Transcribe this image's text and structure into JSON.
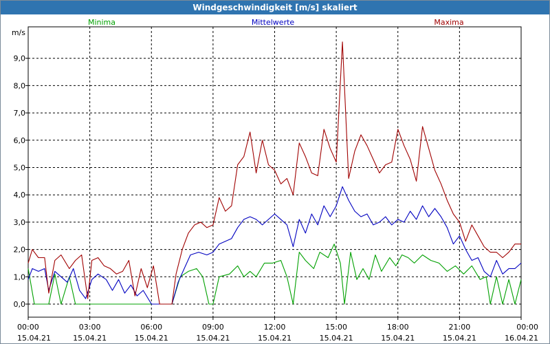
{
  "window": {
    "title": "Windgeschwindigkeit [m/s] skaliert"
  },
  "colors": {
    "minima": "#00a000",
    "mittel": "#0000c0",
    "maxima": "#a00000",
    "grid": "#000000"
  },
  "chart_data": {
    "type": "line",
    "title": "Windgeschwindigkeit [m/s] skaliert",
    "ylabel": "m/s",
    "ylim": [
      -0.5,
      10.0
    ],
    "yticks": [
      "0,0",
      "1,0",
      "2,0",
      "3,0",
      "4,0",
      "5,0",
      "6,0",
      "7,0",
      "8,0",
      "9,0"
    ],
    "grid": true,
    "legend": "top",
    "x_ticks": [
      {
        "time": "00:00",
        "date": "15.04.21"
      },
      {
        "time": "03:00",
        "date": "15.04.21"
      },
      {
        "time": "06:00",
        "date": "15.04.21"
      },
      {
        "time": "09:00",
        "date": "15.04.21"
      },
      {
        "time": "12:00",
        "date": "15.04.21"
      },
      {
        "time": "15:00",
        "date": "15.04.21"
      },
      {
        "time": "18:00",
        "date": "15.04.21"
      },
      {
        "time": "21:00",
        "date": "15.04.21"
      },
      {
        "time": "00:00",
        "date": "16.04.21"
      }
    ],
    "x_unit_note": "x values are hours of 15.04.21 (0-24)",
    "series": [
      {
        "name": "Minima",
        "color": "#00a000",
        "points": [
          [
            0,
            1.3
          ],
          [
            0.3,
            0
          ],
          [
            1.0,
            0
          ],
          [
            1.3,
            1.1
          ],
          [
            1.6,
            0
          ],
          [
            2.0,
            1.0
          ],
          [
            2.3,
            0
          ],
          [
            3.0,
            0
          ],
          [
            4.0,
            0
          ],
          [
            5.0,
            0
          ],
          [
            6.0,
            0
          ],
          [
            7.0,
            0
          ],
          [
            7.4,
            1.0
          ],
          [
            7.8,
            1.2
          ],
          [
            8.2,
            1.3
          ],
          [
            8.5,
            1.0
          ],
          [
            8.8,
            0
          ],
          [
            9.0,
            0
          ],
          [
            9.3,
            1.0
          ],
          [
            9.8,
            1.1
          ],
          [
            10.2,
            1.4
          ],
          [
            10.5,
            1.0
          ],
          [
            10.8,
            1.2
          ],
          [
            11.1,
            1.0
          ],
          [
            11.5,
            1.5
          ],
          [
            11.9,
            1.5
          ],
          [
            12.3,
            1.6
          ],
          [
            12.6,
            1.0
          ],
          [
            12.9,
            0
          ],
          [
            13.2,
            1.9
          ],
          [
            13.5,
            1.6
          ],
          [
            13.9,
            1.3
          ],
          [
            14.2,
            1.9
          ],
          [
            14.6,
            1.7
          ],
          [
            14.9,
            2.2
          ],
          [
            15.2,
            1.5
          ],
          [
            15.4,
            0
          ],
          [
            15.7,
            1.9
          ],
          [
            16.0,
            0.9
          ],
          [
            16.3,
            1.3
          ],
          [
            16.6,
            0.9
          ],
          [
            16.9,
            1.8
          ],
          [
            17.2,
            1.2
          ],
          [
            17.6,
            1.7
          ],
          [
            17.9,
            1.4
          ],
          [
            18.2,
            1.8
          ],
          [
            18.5,
            1.7
          ],
          [
            18.8,
            1.5
          ],
          [
            19.2,
            1.8
          ],
          [
            19.6,
            1.6
          ],
          [
            20.0,
            1.5
          ],
          [
            20.4,
            1.2
          ],
          [
            20.8,
            1.4
          ],
          [
            21.2,
            1.1
          ],
          [
            21.6,
            1.4
          ],
          [
            22.0,
            0.9
          ],
          [
            22.3,
            1.0
          ],
          [
            22.5,
            0
          ],
          [
            22.8,
            1.0
          ],
          [
            23.1,
            0
          ],
          [
            23.4,
            0.9
          ],
          [
            23.7,
            0
          ],
          [
            24.0,
            0.9
          ]
        ]
      },
      {
        "name": "Mittelwerte",
        "color": "#0000c0",
        "points": [
          [
            0,
            0.9
          ],
          [
            0.2,
            1.3
          ],
          [
            0.5,
            1.2
          ],
          [
            0.8,
            1.3
          ],
          [
            1.0,
            0.5
          ],
          [
            1.3,
            1.2
          ],
          [
            1.6,
            1.0
          ],
          [
            1.9,
            0.8
          ],
          [
            2.2,
            1.3
          ],
          [
            2.5,
            0.5
          ],
          [
            2.8,
            0.2
          ],
          [
            3.1,
            0.9
          ],
          [
            3.4,
            1.1
          ],
          [
            3.8,
            0.9
          ],
          [
            4.1,
            0.5
          ],
          [
            4.4,
            0.9
          ],
          [
            4.7,
            0.4
          ],
          [
            5.0,
            0.7
          ],
          [
            5.3,
            0.3
          ],
          [
            5.6,
            0.5
          ],
          [
            6.0,
            0
          ],
          [
            6.5,
            0
          ],
          [
            7.0,
            0
          ],
          [
            7.3,
            0.8
          ],
          [
            7.6,
            1.3
          ],
          [
            7.9,
            1.8
          ],
          [
            8.3,
            1.9
          ],
          [
            8.7,
            1.8
          ],
          [
            9.0,
            1.9
          ],
          [
            9.3,
            2.2
          ],
          [
            9.6,
            2.3
          ],
          [
            9.9,
            2.4
          ],
          [
            10.2,
            2.8
          ],
          [
            10.5,
            3.1
          ],
          [
            10.8,
            3.2
          ],
          [
            11.1,
            3.1
          ],
          [
            11.4,
            2.9
          ],
          [
            11.7,
            3.1
          ],
          [
            12.0,
            3.3
          ],
          [
            12.3,
            3.1
          ],
          [
            12.6,
            2.9
          ],
          [
            12.9,
            2.1
          ],
          [
            13.2,
            3.1
          ],
          [
            13.5,
            2.6
          ],
          [
            13.8,
            3.3
          ],
          [
            14.1,
            2.9
          ],
          [
            14.4,
            3.6
          ],
          [
            14.7,
            3.2
          ],
          [
            15.0,
            3.6
          ],
          [
            15.3,
            4.3
          ],
          [
            15.6,
            3.8
          ],
          [
            15.9,
            3.4
          ],
          [
            16.2,
            3.2
          ],
          [
            16.5,
            3.3
          ],
          [
            16.8,
            2.9
          ],
          [
            17.1,
            3.0
          ],
          [
            17.4,
            3.2
          ],
          [
            17.7,
            2.9
          ],
          [
            18.0,
            3.1
          ],
          [
            18.3,
            3.0
          ],
          [
            18.6,
            3.4
          ],
          [
            18.9,
            3.1
          ],
          [
            19.2,
            3.6
          ],
          [
            19.5,
            3.2
          ],
          [
            19.8,
            3.5
          ],
          [
            20.1,
            3.2
          ],
          [
            20.4,
            2.8
          ],
          [
            20.7,
            2.2
          ],
          [
            21.0,
            2.5
          ],
          [
            21.3,
            2.0
          ],
          [
            21.6,
            1.6
          ],
          [
            21.9,
            1.7
          ],
          [
            22.2,
            1.2
          ],
          [
            22.5,
            1.0
          ],
          [
            22.8,
            1.6
          ],
          [
            23.1,
            1.1
          ],
          [
            23.4,
            1.3
          ],
          [
            23.7,
            1.3
          ],
          [
            24.0,
            1.5
          ]
        ]
      },
      {
        "name": "Maxima",
        "color": "#a00000",
        "points": [
          [
            0,
            1.5
          ],
          [
            0.2,
            2.0
          ],
          [
            0.5,
            1.7
          ],
          [
            0.8,
            1.7
          ],
          [
            1.0,
            0.4
          ],
          [
            1.3,
            1.6
          ],
          [
            1.6,
            1.8
          ],
          [
            2.0,
            1.3
          ],
          [
            2.3,
            1.6
          ],
          [
            2.6,
            1.8
          ],
          [
            2.9,
            0.2
          ],
          [
            3.1,
            1.6
          ],
          [
            3.4,
            1.7
          ],
          [
            3.7,
            1.4
          ],
          [
            4.0,
            1.3
          ],
          [
            4.3,
            1.1
          ],
          [
            4.6,
            1.2
          ],
          [
            4.9,
            1.6
          ],
          [
            5.2,
            0.3
          ],
          [
            5.5,
            1.3
          ],
          [
            5.8,
            0.6
          ],
          [
            6.1,
            1.4
          ],
          [
            6.4,
            0
          ],
          [
            7.0,
            0
          ],
          [
            7.2,
            1.1
          ],
          [
            7.5,
            2.0
          ],
          [
            7.8,
            2.6
          ],
          [
            8.1,
            2.9
          ],
          [
            8.4,
            3.0
          ],
          [
            8.7,
            2.8
          ],
          [
            9.0,
            2.9
          ],
          [
            9.3,
            3.9
          ],
          [
            9.6,
            3.4
          ],
          [
            9.9,
            3.6
          ],
          [
            10.2,
            5.1
          ],
          [
            10.5,
            5.4
          ],
          [
            10.8,
            6.3
          ],
          [
            11.1,
            4.8
          ],
          [
            11.4,
            6.0
          ],
          [
            11.7,
            5.1
          ],
          [
            12.0,
            4.9
          ],
          [
            12.3,
            4.4
          ],
          [
            12.6,
            4.6
          ],
          [
            12.9,
            4.0
          ],
          [
            13.2,
            5.9
          ],
          [
            13.5,
            5.4
          ],
          [
            13.8,
            4.8
          ],
          [
            14.1,
            4.7
          ],
          [
            14.4,
            6.4
          ],
          [
            14.7,
            5.7
          ],
          [
            15.0,
            5.2
          ],
          [
            15.3,
            9.6
          ],
          [
            15.6,
            4.6
          ],
          [
            15.9,
            5.6
          ],
          [
            16.2,
            6.2
          ],
          [
            16.5,
            5.8
          ],
          [
            16.8,
            5.3
          ],
          [
            17.1,
            4.8
          ],
          [
            17.4,
            5.1
          ],
          [
            17.7,
            5.2
          ],
          [
            18.0,
            6.4
          ],
          [
            18.3,
            5.8
          ],
          [
            18.6,
            5.3
          ],
          [
            18.9,
            4.5
          ],
          [
            19.2,
            6.5
          ],
          [
            19.5,
            5.7
          ],
          [
            19.8,
            4.9
          ],
          [
            20.1,
            4.4
          ],
          [
            20.4,
            3.8
          ],
          [
            20.7,
            3.3
          ],
          [
            21.0,
            3.0
          ],
          [
            21.3,
            2.3
          ],
          [
            21.6,
            2.9
          ],
          [
            21.9,
            2.5
          ],
          [
            22.2,
            2.1
          ],
          [
            22.5,
            1.9
          ],
          [
            22.8,
            1.9
          ],
          [
            23.1,
            1.7
          ],
          [
            23.4,
            1.9
          ],
          [
            23.7,
            2.2
          ],
          [
            24.0,
            2.2
          ]
        ]
      }
    ]
  }
}
